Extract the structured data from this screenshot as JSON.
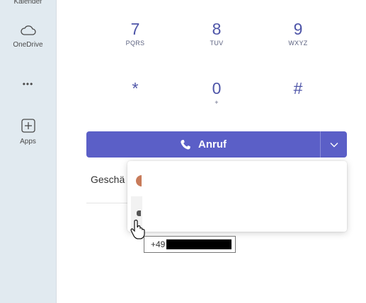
{
  "sidebar": {
    "items": [
      {
        "label": "Kalender",
        "icon": "calendar-icon"
      },
      {
        "label": "OneDrive",
        "icon": "cloud-icon"
      },
      {
        "label": "",
        "icon": "more-icon"
      },
      {
        "label": "Apps",
        "icon": "add-apps-icon"
      }
    ],
    "more_glyph": "•••"
  },
  "dialpad": {
    "keys": [
      {
        "digit": "7",
        "letters": "PQRS"
      },
      {
        "digit": "8",
        "letters": "TUV"
      },
      {
        "digit": "9",
        "letters": "WXYZ"
      },
      {
        "digit": "*",
        "letters": ""
      },
      {
        "digit": "0",
        "letters": "+"
      },
      {
        "digit": "#",
        "letters": ""
      }
    ]
  },
  "call": {
    "label": "Anruf",
    "accent": "#5b5fc7"
  },
  "background": {
    "label": "Geschä"
  },
  "tooltip": {
    "prefix": "+49"
  }
}
